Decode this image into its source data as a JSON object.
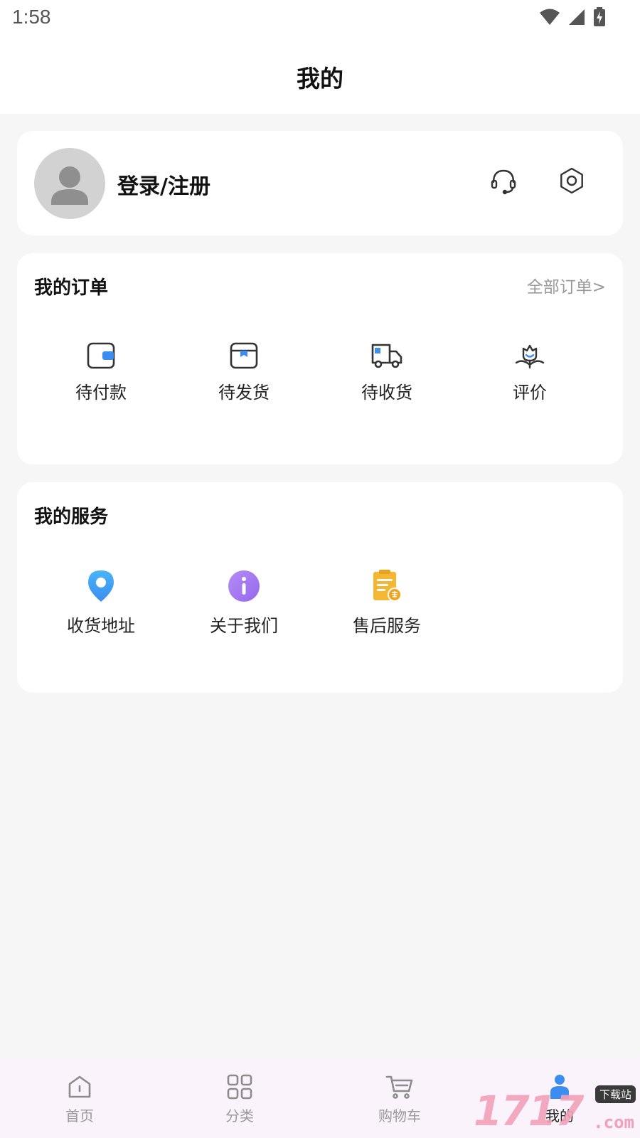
{
  "status_bar": {
    "time": "1:58",
    "icons": [
      "wifi-icon",
      "signal-icon",
      "battery-charging-icon"
    ]
  },
  "header": {
    "title": "我的"
  },
  "profile": {
    "login_label": "登录/注册",
    "avatar_icon": "user-avatar-icon",
    "support_icon": "headset-icon",
    "settings_icon": "gear-icon"
  },
  "orders": {
    "title": "我的订单",
    "all_link": "全部订单>",
    "items": [
      {
        "label": "待付款",
        "icon": "wallet-icon"
      },
      {
        "label": "待发货",
        "icon": "package-box-icon"
      },
      {
        "label": "待收货",
        "icon": "delivery-truck-icon"
      },
      {
        "label": "评价",
        "icon": "review-flower-icon"
      }
    ]
  },
  "services": {
    "title": "我的服务",
    "items": [
      {
        "label": "收货地址",
        "icon": "location-pin-icon"
      },
      {
        "label": "关于我们",
        "icon": "info-icon"
      },
      {
        "label": "售后服务",
        "icon": "after-sales-clipboard-icon"
      }
    ]
  },
  "tab_bar": {
    "tabs": [
      {
        "label": "首页",
        "icon": "home-icon"
      },
      {
        "label": "分类",
        "icon": "grid-icon"
      },
      {
        "label": "购物车",
        "icon": "cart-icon"
      },
      {
        "label": "我的",
        "icon": "person-icon",
        "active": true
      }
    ]
  },
  "watermark": {
    "text": "1717",
    "badge": "下载站",
    "suffix": ".com"
  },
  "colors": {
    "accent_blue": "#3b8ef0",
    "accent_purple": "#a77cf2",
    "accent_orange": "#f5b731",
    "tab_bar_bg": "#fbf3fb"
  }
}
